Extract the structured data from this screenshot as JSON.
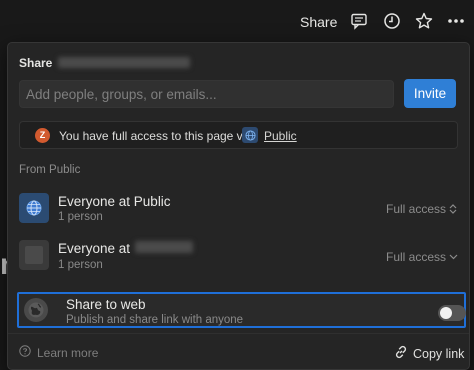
{
  "topbar": {
    "share_label": "Share",
    "icons": [
      "comment-icon",
      "history-icon",
      "star-icon",
      "more-icon"
    ]
  },
  "background": {
    "letter": "n"
  },
  "panel": {
    "title": "Share",
    "input_placeholder": "Add people, groups, or emails...",
    "invite_label": "Invite",
    "access_notice": {
      "avatar_initial": "Z",
      "text": "You have full access to this page via",
      "link": "Public"
    },
    "section_label": "From Public",
    "rows": [
      {
        "title": "Everyone at Public",
        "subtitle": "1 person",
        "access": "Full access"
      },
      {
        "title": "Everyone at",
        "subtitle": "1 person",
        "access": "Full access"
      }
    ],
    "share_to_web": {
      "title": "Share to web",
      "subtitle": "Publish and share link with anyone",
      "enabled": false
    },
    "footer": {
      "learn_more": "Learn more",
      "copy_link": "Copy link"
    }
  },
  "colors": {
    "accent": "#2f7fd6",
    "highlight_border": "#1f6fd8",
    "panel_bg": "#252525",
    "page_bg": "#191919"
  }
}
